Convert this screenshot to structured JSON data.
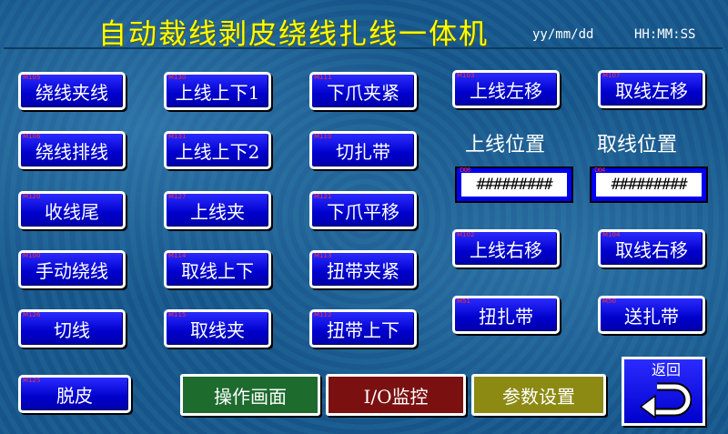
{
  "header": {
    "title": "自动裁线剥皮绕线扎线一体机",
    "date": "yy/mm/dd",
    "time": "HH:MM:SS"
  },
  "buttons": {
    "b01": {
      "label": "绕线夹线",
      "tag": "M105"
    },
    "b02": {
      "label": "绕线排线",
      "tag": "M106"
    },
    "b03": {
      "label": "收线尾",
      "tag": "M120"
    },
    "b04": {
      "label": "手动绕线",
      "tag": "M100"
    },
    "b05": {
      "label": "切线",
      "tag": "M126"
    },
    "b06": {
      "label": "脱皮",
      "tag": "M125"
    },
    "b07": {
      "label": "上线上下1",
      "tag": "M130"
    },
    "b08": {
      "label": "上线上下2",
      "tag": "M131"
    },
    "b09": {
      "label": "上线夹",
      "tag": "M127"
    },
    "b10": {
      "label": "取线上下",
      "tag": "M114"
    },
    "b11": {
      "label": "取线夹",
      "tag": "M115"
    },
    "b12": {
      "label": "下爪夹紧",
      "tag": "M111"
    },
    "b13": {
      "label": "切扎带",
      "tag": "M110"
    },
    "b14": {
      "label": "下爪平移",
      "tag": "M121"
    },
    "b15": {
      "label": "扭带夹紧",
      "tag": "M113"
    },
    "b16": {
      "label": "扭带上下",
      "tag": "M112"
    },
    "b17": {
      "label": "上线左移",
      "tag": "M103"
    },
    "b18": {
      "label": "上线右移",
      "tag": "M102"
    },
    "b19": {
      "label": "扭扎带",
      "tag": "M51"
    },
    "b20": {
      "label": "取线左移",
      "tag": "M107"
    },
    "b21": {
      "label": "取线右移",
      "tag": "M104"
    },
    "b22": {
      "label": "送扎带",
      "tag": "M50"
    }
  },
  "positions": {
    "load_label": "上线位置",
    "take_label": "取线位置",
    "load_value": "#########",
    "take_value": "#########",
    "load_tag": "D08",
    "take_tag": "D04"
  },
  "footer": {
    "operate": "操作画面",
    "io": "I/O监控",
    "params": "参数设置",
    "back": "返回"
  },
  "colors": {
    "title": "#ffff00",
    "button": "#0000cc",
    "operate": "#1e6b2e",
    "io": "#7a1010",
    "params": "#8c8a12"
  }
}
